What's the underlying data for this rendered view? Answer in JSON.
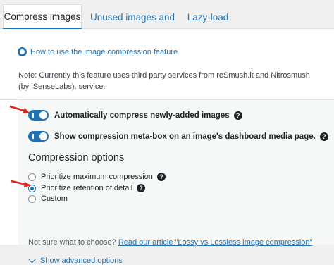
{
  "tabs": [
    {
      "label": "Compress images",
      "active": true
    },
    {
      "label": "Unused images and sizes",
      "active": false
    },
    {
      "label": "Lazy-load",
      "active": false
    }
  ],
  "howto_link": "How to use the image compression feature",
  "note": "Note: Currently this feature uses third party services from reSmush.it and Nitrosmush (by iSenseLabs). service.",
  "toggles": [
    {
      "label": "Automatically compress newly-added images",
      "on": true,
      "has_help": true
    },
    {
      "label": "Show compression meta-box on an image's dashboard media page.",
      "on": true,
      "has_help": true
    }
  ],
  "compression": {
    "heading": "Compression options",
    "options": [
      {
        "label": "Prioritize maximum compression",
        "checked": false,
        "has_help": true
      },
      {
        "label": "Prioritize retention of detail",
        "checked": true,
        "has_help": true
      },
      {
        "label": "Custom",
        "checked": false,
        "has_help": false
      }
    ]
  },
  "not_sure": {
    "prefix": "Not sure what to choose?",
    "link": "Read our article \"Lossy vs Lossless image compression\""
  },
  "advanced_link": "Show advanced options",
  "colors": {
    "accent": "#2271b1",
    "annotation_arrow": "#e0261b"
  }
}
